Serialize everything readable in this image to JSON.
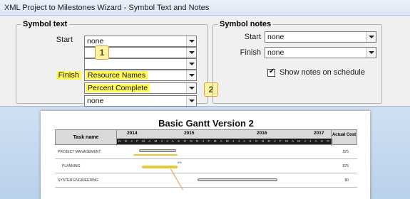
{
  "window": {
    "title": "XML Project to Milestones Wizard - Symbol Text and Notes"
  },
  "symbol_text": {
    "legend": "Symbol text",
    "start_label": "Start",
    "finish_label": "Finish",
    "start_values": [
      "none",
      "",
      ""
    ],
    "finish_values": [
      "Resource Names",
      "Percent Complete",
      "none"
    ]
  },
  "symbol_notes": {
    "legend": "Symbol notes",
    "start_label": "Start",
    "finish_label": "Finish",
    "start_value": "none",
    "finish_value": "none",
    "show_notes_label": "Show notes on schedule",
    "show_notes_checked": true
  },
  "callouts": [
    "1",
    "2"
  ],
  "gantt_preview": {
    "title": "Basic Gantt Version 2",
    "task_header": "Task name",
    "cost_header": "Actual Cost",
    "years": [
      "2014",
      "2015",
      "2016",
      "2017"
    ],
    "months_strip": "N D J F M A M J J A S O N D J F M A M J J A S O N D J F M A M J J A S O N D J F M A M",
    "rows": [
      {
        "name": "PROJECT MANAGEMENT",
        "cost": "$75",
        "percent": ""
      },
      {
        "name": "PLANNING",
        "cost": "$75",
        "percent": "0%"
      },
      {
        "name": "SYSTEM ENGINEERING",
        "cost": "$0",
        "percent": ""
      }
    ]
  },
  "colors": {
    "highlight": "#fff95a",
    "callout_fill": "#fdf3a8",
    "callout_border": "#d9a23a"
  }
}
